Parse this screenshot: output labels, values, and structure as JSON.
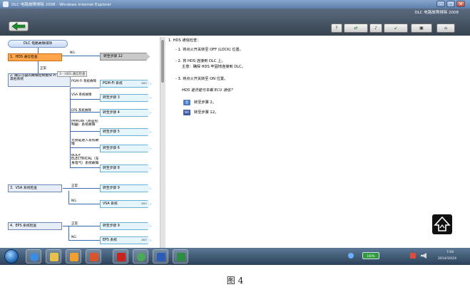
{
  "window": {
    "title": "DLC 电路故障排除 2008 - Windows Internet Explorer",
    "min_label": "–",
    "max_label": "□",
    "close_label": "✕"
  },
  "app": {
    "title": "DLC 电路故障排除 2008",
    "back_icon": "back-arrow-icon",
    "toolbar": {
      "b1": "?",
      "b2": "⇄",
      "b3": "♪",
      "b4": "↙",
      "b5": "▣",
      "b6": "⌂"
    }
  },
  "flow": {
    "start": "DLC 电路故障排除",
    "step1": {
      "num": "1.",
      "label": "HDS 通信检查"
    },
    "ng_label": "NG",
    "ok_label": "正常",
    "go12": "转至步骤 12",
    "tooltip": "3 - HDS 通信检查",
    "step2": {
      "num": "2.",
      "label": "确认可疑的故障控制模块 PI 系统：其他系统"
    },
    "branch_pgm": "PGM-FI 系统故障",
    "pgm_result": "PGM-FI 系统",
    "vsa_branch": "VSA 系统故障",
    "go3": "转至步骤 3",
    "eps_branch": "EPS 系统故障",
    "go4": "转至步骤 4",
    "immob_branch": "IMMOBI（防盗控制器）系统故障",
    "go5": "转至步骤 5",
    "keyless_branch": "无钥匙进入系统故障",
    "go6": "转至步骤 6",
    "body_branch": "BODY ELECTRICAL（车身电气）系统故障",
    "go8": "转至步骤 8",
    "step3": {
      "num": "3.",
      "label": "VSA 系统检查"
    },
    "normal": "正常",
    "go9": "转至步骤 9",
    "ng": "NG",
    "vsa_result": "VSA 系统",
    "step4": {
      "num": "4.",
      "label": "EPS 系统检查"
    },
    "eps_result": "EPS 系统",
    "sub_label": "DSO"
  },
  "right": {
    "heading": "1.  HDS 通信检查：",
    "item1": "-  1. 将点火开关转至 OFF (LOCK) 位置。",
    "item2a": "-  2. 将 HDS 连接到 DLC 上。",
    "item2b": "主意：确保 HDS 牢固地连接到 DLC。",
    "item3": "-  3. 将点火开关转至 ON 位置。",
    "question": "HDS 是否能与车载 ECU 通信？",
    "yes_badge": "是",
    "yes_text": "转至步骤 2。",
    "no_badge": "NO",
    "no_text": "转至步骤 12。"
  },
  "taskbar": {
    "battery": "100%",
    "time": "7:04",
    "date": "2014/10/24"
  },
  "caption": "图 4",
  "colors": {
    "accent_blue": "#3a6ab0",
    "orange": "#ffa64d",
    "result_fill": "#e6f4fb",
    "yes_badge": "#4a7fc8",
    "no_badge": "#3b5aa8"
  }
}
